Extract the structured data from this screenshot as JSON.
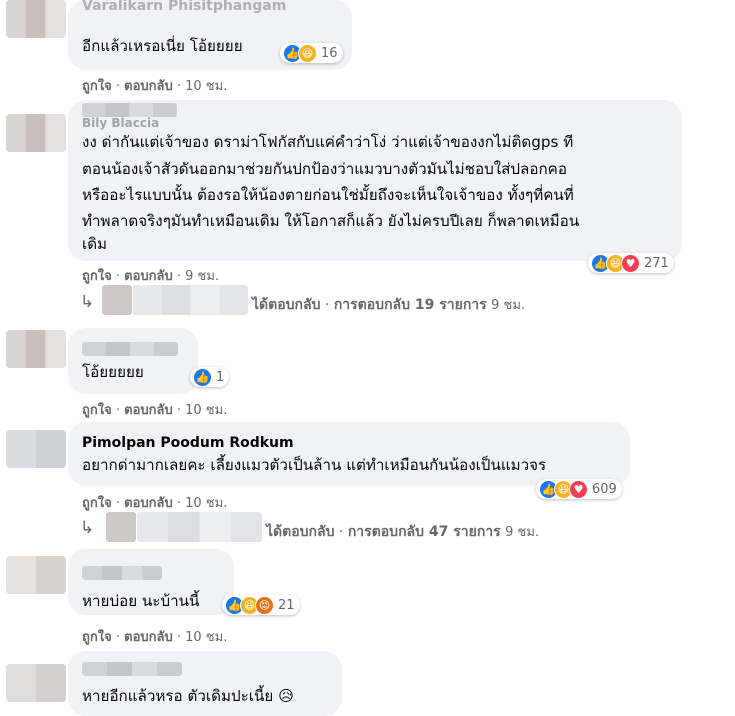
{
  "comments": [
    {
      "name": "Varalikarn Phisitphangam",
      "text": [
        "อีกแล้วเหรอเนี่ย โอ้ยยยย"
      ],
      "like_label": "ถูกใจ",
      "reply_label": "ตอบกลับ",
      "time": "10 ชม.",
      "reaction_count": "16",
      "reactions": [
        "like-icon",
        "haha-icon"
      ]
    },
    {
      "name": "Bily Blaccia",
      "text": [
        "งง ด่ากันแต่เจ้าของ ดราม่าโฟกัสกับแค่คำว่าโง่ ว่าแต่เจ้าของงกไม่ติดgps ที",
        "ตอนน้องเจ้าสัวดันออกมาช่วยกันปกป้องว่าแมวบางตัวมันไม่ชอบใส่ปลอกคอ",
        "หรืออะไรแบบนั้น ต้องรอให้น้องตายก่อนใช่มั้ยถึงจะเห็นใจเจ้าของ ทั้งๆที่คนที่",
        "ทำพลาดจริงๆมันทำเหมือนเดิม ให้โอกาสก็แล้ว ยังไม่ครบปีเลย ก็พลาดเหมือน",
        "เดิม"
      ],
      "like_label": "ถูกใจ",
      "reply_label": "ตอบกลับ",
      "time": "9 ชม.",
      "reaction_count": "271",
      "reactions": [
        "like-icon",
        "haha-icon",
        "love-icon"
      ],
      "replies": {
        "prefix": "ได้ตอบกลับ",
        "sep": "·",
        "count_label": "การตอบกลับ 19 รายการ",
        "time": "9 ชม."
      }
    },
    {
      "name": "",
      "text": [
        "โอ้ยยยยย"
      ],
      "like_label": "ถูกใจ",
      "reply_label": "ตอบกลับ",
      "time": "10 ชม.",
      "reaction_count": "1",
      "reactions": [
        "like-icon"
      ]
    },
    {
      "name": "Pimolpan Poodum Rodkum",
      "text": [
        "อยากด่ามากเลยคะ เลี้ยงแมวตัวเป็นล้าน แต่ทำเหมือนกันน้องเป็นแมวจร"
      ],
      "like_label": "ถูกใจ",
      "reply_label": "ตอบกลับ",
      "time": "10 ชม.",
      "reaction_count": "609",
      "reactions": [
        "like-icon",
        "haha-icon",
        "love-icon"
      ],
      "replies": {
        "prefix": "ได้ตอบกลับ",
        "sep": "·",
        "count_label": "การตอบกลับ 47 รายการ",
        "time": "9 ชม."
      }
    },
    {
      "name": "",
      "text": [
        "หายบ่อย นะบ้านนี้"
      ],
      "like_label": "ถูกใจ",
      "reply_label": "ตอบกลับ",
      "time": "10 ชม.",
      "reaction_count": "21",
      "reactions": [
        "like-icon",
        "haha-icon",
        "angry-icon"
      ]
    },
    {
      "name": "",
      "text": [
        "หายอีกแล้วหรอ ตัวเดิมปะเนี้ย 😥"
      ]
    }
  ],
  "colors": {
    "bubble": "#f0f2f5",
    "meta": "#65676b",
    "like": "#1877f2",
    "love": "#f33e58",
    "haha": "#f7b125"
  }
}
